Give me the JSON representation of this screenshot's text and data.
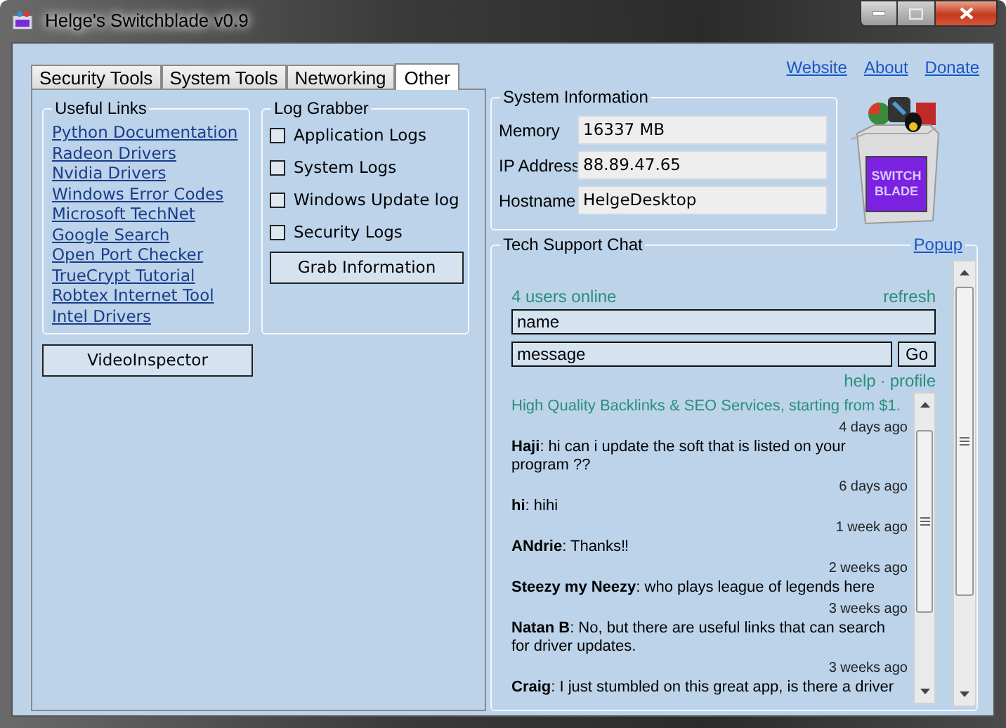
{
  "window": {
    "title": "Helge's Switchblade v0.9"
  },
  "tabs": [
    {
      "label": "Security Tools",
      "selected": false
    },
    {
      "label": "System Tools",
      "selected": false
    },
    {
      "label": "Networking",
      "selected": false
    },
    {
      "label": "Other",
      "selected": true
    }
  ],
  "useful_links": {
    "title": "Useful Links",
    "links": [
      "Python Documentation",
      "Radeon Drivers",
      "Nvidia Drivers",
      "Windows Error Codes",
      "Microsoft TechNet",
      "Google Search",
      "Open Port Checker",
      "TrueCrypt Tutorial",
      "Robtex Internet Tool",
      "Intel Drivers"
    ]
  },
  "log_grabber": {
    "title": "Log Grabber",
    "options": [
      {
        "label": "Application Logs",
        "checked": false
      },
      {
        "label": "System Logs",
        "checked": false
      },
      {
        "label": "Windows Update log",
        "checked": false
      },
      {
        "label": "Security Logs",
        "checked": false
      }
    ],
    "button": "Grab Information"
  },
  "video_button": "VideoInspector",
  "header_links": [
    "Website",
    "About",
    "Donate"
  ],
  "system_information": {
    "title": "System Information",
    "fields": [
      {
        "label": "Memory",
        "value": "16337 MB"
      },
      {
        "label": "IP Address",
        "value": "88.89.47.65"
      },
      {
        "label": "Hostname",
        "value": "HelgeDesktop"
      }
    ]
  },
  "logo": {
    "lines": [
      "SWITCH",
      "BLADE"
    ]
  },
  "chat": {
    "title": "Tech Support Chat",
    "popup": "Popup",
    "users_online": "4 users online",
    "refresh": "refresh",
    "name_placeholder": "name",
    "message_placeholder": "message",
    "go": "Go",
    "help": "help",
    "separator": "·",
    "profile": "profile",
    "ad": "High Quality Backlinks & SEO Services, starting from $1.",
    "messages": [
      {
        "time": "4 days ago",
        "author": "Haji",
        "text": ": hi can i update the soft that is listed on your program ??"
      },
      {
        "time": "6 days ago",
        "author": "hi",
        "text": ": hihi"
      },
      {
        "time": "1 week ago",
        "author": "ANdrie",
        "text": ": Thanks‼"
      },
      {
        "time": "2 weeks ago",
        "author": "Steezy my Neezy",
        "text": ": who plays league of legends here"
      },
      {
        "time": "3 weeks ago",
        "author": "Natan B",
        "text": ": No, but there are useful links that can search for driver updates."
      },
      {
        "time": "3 weeks ago",
        "author": "Craig",
        "text": ": I just stumbled on this great app, is there a driver"
      }
    ]
  }
}
